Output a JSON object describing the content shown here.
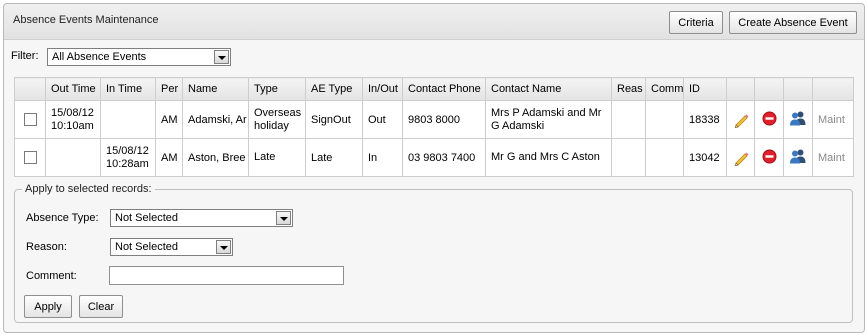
{
  "panel": {
    "title": "Absence Events Maintenance",
    "criteria_button": "Criteria",
    "create_button": "Create Absence Event"
  },
  "filter": {
    "label": "Filter:",
    "selected": "All Absence Events"
  },
  "table": {
    "columns": [
      "",
      "Out Time",
      "In Time",
      "Per",
      "Name",
      "Type",
      "AE Type",
      "In/Out",
      "Contact Phone",
      "Contact Name",
      "Reas",
      "Comm",
      "ID",
      "",
      "",
      "",
      ""
    ],
    "rows": [
      {
        "out_time": "15/08/12 10:10am",
        "in_time": "",
        "per": "AM",
        "name": "Adamski, Ar",
        "type": "Overseas holiday",
        "ae_type": "SignOut",
        "in_out": "Out",
        "contact_phone": "9803 8000",
        "contact_name": "Mrs P Adamski and Mr G Adamski",
        "reason": "",
        "comment": "",
        "id": "18338",
        "maint": "Maint"
      },
      {
        "out_time": "",
        "in_time": "15/08/12 10:28am",
        "per": "AM",
        "name": "Aston, Bree",
        "type": "Late",
        "ae_type": "Late",
        "in_out": "In",
        "contact_phone": "03 9803 7400",
        "contact_name": "Mr G and Mrs C Aston",
        "reason": "",
        "comment": "",
        "id": "13042",
        "maint": "Maint"
      }
    ]
  },
  "apply": {
    "legend": "Apply to selected records:",
    "absence_type_label": "Absence Type:",
    "absence_type_value": "Not Selected",
    "reason_label": "Reason:",
    "reason_value": "Not Selected",
    "comment_label": "Comment:",
    "comment_value": "",
    "apply_button": "Apply",
    "clear_button": "Clear"
  },
  "icons": {
    "edit": "pencil-icon",
    "delete": "delete-icon",
    "contacts": "contacts-icon"
  },
  "colors": {
    "delete_red": "#e0202a",
    "pencil_yellow": "#f3c23a",
    "person_blue": "#3a78c2"
  }
}
